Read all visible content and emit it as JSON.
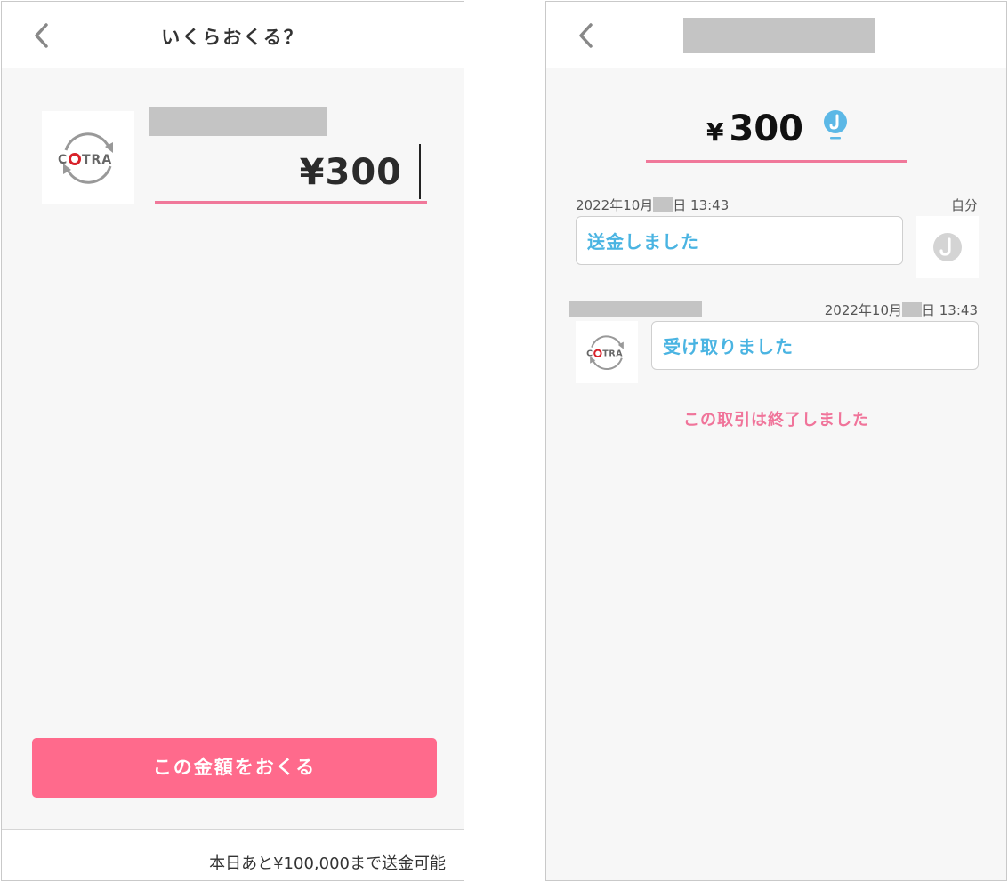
{
  "left": {
    "header": {
      "title": "いくらおくる？"
    },
    "recipient": {
      "logo_text": "COTRA"
    },
    "amount": {
      "value": "¥300"
    },
    "send_button": {
      "label": "この金額をおくる"
    },
    "footer": {
      "note": "本日あと¥100,000まで送金可能"
    }
  },
  "right": {
    "amount": {
      "yen": "¥",
      "value": "300"
    },
    "messages": [
      {
        "timestamp": "2022年10月",
        "timestamp_suffix": "日 13:43",
        "sender": "自分",
        "text": "送金しました"
      },
      {
        "timestamp": "2022年10月",
        "timestamp_suffix": "日 13:43",
        "text": "受け取りました",
        "logo_text": "COTRA"
      }
    ],
    "status": {
      "text": "この取引は終了しました"
    }
  },
  "colors": {
    "accent_pink": "#ff6a8c",
    "bubble_text": "#4ab4e2",
    "underline": "#f0789a"
  }
}
